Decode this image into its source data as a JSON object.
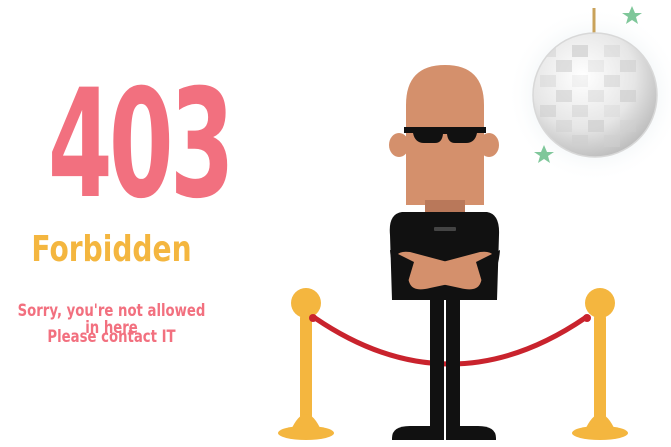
{
  "error": {
    "code": "403",
    "status": "Forbidden",
    "message_line1": "Sorry, you're not allowed in here",
    "message_line2": "Please contact IT"
  },
  "colors": {
    "accent_pink": "#f2707f",
    "accent_gold": "#f4b63f",
    "rope_red": "#c9232d",
    "skin": "#d4906c",
    "clothing": "#111111",
    "star_green": "#7fc79a"
  },
  "illustration": {
    "subject": "bouncer",
    "icons": [
      "disco-ball-icon",
      "star-icon",
      "stanchion-icon",
      "velvet-rope-icon"
    ]
  }
}
